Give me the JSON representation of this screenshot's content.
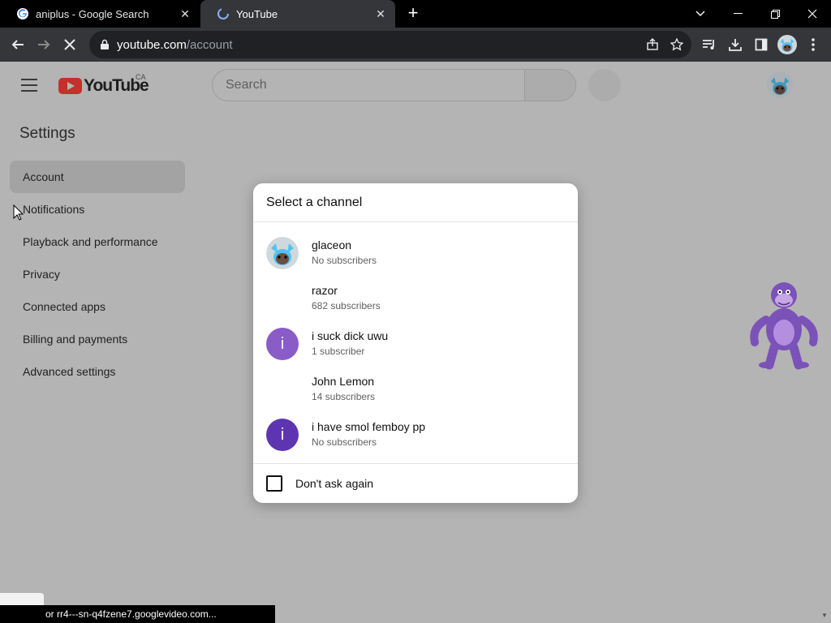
{
  "browser": {
    "tabs": [
      {
        "title": "aniplus - Google Search",
        "favicon": "google-icon",
        "active": false
      },
      {
        "title": "YouTube",
        "favicon": "loading-icon",
        "active": true
      }
    ],
    "new_tab_label": "+",
    "url_host": "youtube.com",
    "url_path": "/account",
    "status_text": "or rr4---sn-q4fzene7.googlevideo.com..."
  },
  "youtube": {
    "logo_text": "YouTube",
    "region": "CA",
    "search_placeholder": "Search",
    "settings_title": "Settings",
    "nav": [
      {
        "label": "Account",
        "selected": true
      },
      {
        "label": "Notifications",
        "selected": false
      },
      {
        "label": "Playback and performance",
        "selected": false
      },
      {
        "label": "Privacy",
        "selected": false
      },
      {
        "label": "Connected apps",
        "selected": false
      },
      {
        "label": "Billing and payments",
        "selected": false
      },
      {
        "label": "Advanced settings",
        "selected": false
      }
    ]
  },
  "dialog": {
    "title": "Select a channel",
    "channels": [
      {
        "name": "glaceon",
        "subs": "No subscribers",
        "avatar": "glaceon-avatar"
      },
      {
        "name": "razor",
        "subs": "682 subscribers",
        "avatar": "none"
      },
      {
        "name": "i suck dick uwu",
        "subs": "1 subscriber",
        "avatar": "letter",
        "letter": "i",
        "color": "#8a5cc8"
      },
      {
        "name": "John Lemon",
        "subs": "14 subscribers",
        "avatar": "none"
      },
      {
        "name": "i have smol femboy pp",
        "subs": "No subscribers",
        "avatar": "letter",
        "letter": "i",
        "color": "#5e35b1"
      }
    ],
    "dont_ask_label": "Don't ask again"
  },
  "colors": {
    "yt_red": "#c4302b",
    "dim_bg": "#b4b4b4",
    "toolbar": "#35363a"
  }
}
